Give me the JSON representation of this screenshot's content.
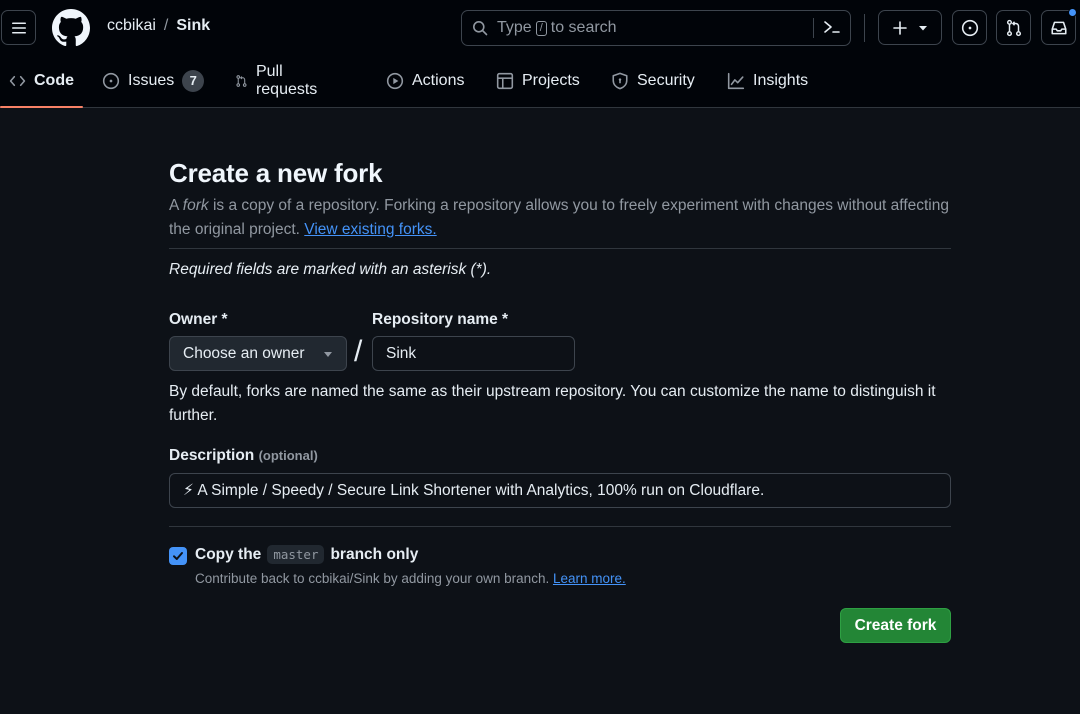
{
  "header": {
    "owner": "ccbikai",
    "separator": "/",
    "repo": "Sink",
    "search": {
      "prefix": "Type",
      "key": "/",
      "suffix": "to search"
    }
  },
  "tabs": [
    {
      "label": "Code",
      "icon": "code-icon",
      "selected": true
    },
    {
      "label": "Issues",
      "icon": "issue-opened-icon",
      "counter": "7"
    },
    {
      "label": "Pull requests",
      "icon": "git-pull-request-icon"
    },
    {
      "label": "Actions",
      "icon": "play-icon"
    },
    {
      "label": "Projects",
      "icon": "table-icon"
    },
    {
      "label": "Security",
      "icon": "shield-icon"
    },
    {
      "label": "Insights",
      "icon": "graph-icon"
    }
  ],
  "form": {
    "title": "Create a new fork",
    "intro_pre": "A ",
    "intro_em": "fork",
    "intro_post": " is a copy of a repository. Forking a repository allows you to freely experiment with changes without affecting the original project. ",
    "intro_link": "View existing forks.",
    "required_note": "Required fields are marked with an asterisk (*).",
    "owner_label": "Owner *",
    "owner_select": "Choose an owner",
    "slash": "/",
    "repo_label": "Repository name *",
    "repo_value": "Sink",
    "hint": "By default, forks are named the same as their upstream repository. You can customize the name to distinguish it further.",
    "description_label": "Description",
    "description_optional": "(optional)",
    "description_value": "⚡ A Simple / Speedy / Secure Link Shortener with Analytics, 100% run on Cloudflare.",
    "copy_pre": "Copy the",
    "copy_branch": "master",
    "copy_post": "branch only",
    "contrib_text": "Contribute back to ccbikai/Sink by adding your own branch. ",
    "contrib_link": "Learn more.",
    "submit_label": "Create fork"
  },
  "colors": {
    "background": "#0d1117",
    "header_bg": "#010409",
    "accent_blue": "#4493f8",
    "tab_underline": "#f78166",
    "primary_button": "#238636"
  }
}
